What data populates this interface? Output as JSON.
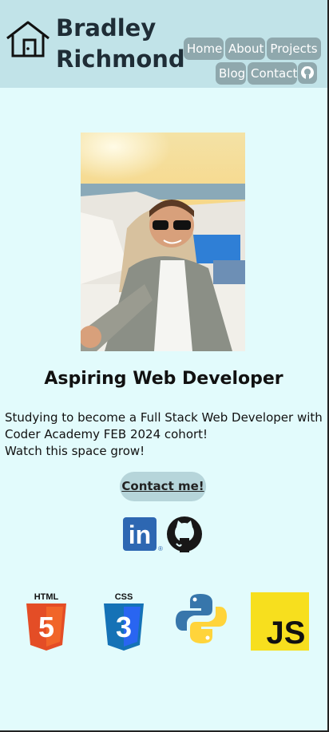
{
  "header": {
    "title_line1": "Bradley",
    "title_line2": "Richmond",
    "logo_icon": "house-icon"
  },
  "nav": {
    "home": "Home",
    "about": "About",
    "projects": "Projects",
    "blog": "Blog",
    "contact": "Contact",
    "github_icon": "github-icon"
  },
  "main": {
    "headline": "Aspiring Web Developer",
    "bio_line1": "Studying to become a Full Stack Web Developer with",
    "bio_line2": "Coder Academy FEB 2024 cohort!",
    "bio_line3": "Watch this space grow!",
    "contact_button": "Contact me!"
  },
  "social": {
    "linkedin_text": "in",
    "linkedin_mark": "®"
  },
  "tech": {
    "html_label": "HTML",
    "html_number": "5",
    "css_label": "CSS",
    "css_number": "3",
    "js_label": "JS"
  },
  "colors": {
    "background": "#e2fbfc",
    "header": "#c1e3e8",
    "nav_button": "#8fa8ad",
    "contact_button": "#b6d5da",
    "linkedin": "#2d67b2",
    "html": "#e44d26",
    "css": "#2965f1",
    "js": "#f7df1e"
  }
}
